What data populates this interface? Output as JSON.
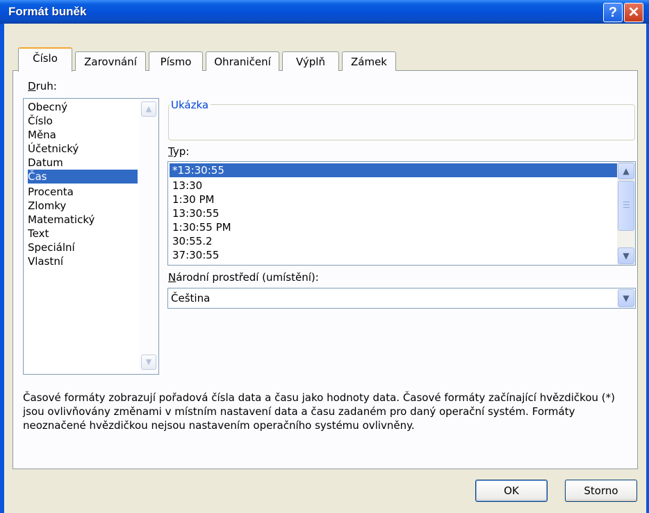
{
  "window": {
    "title": "Formát buněk",
    "help_glyph": "?",
    "close_glyph": "✕"
  },
  "tabs": [
    {
      "label": "Číslo",
      "active": true
    },
    {
      "label": "Zarovnání",
      "active": false
    },
    {
      "label": "Písmo",
      "active": false
    },
    {
      "label": "Ohraničení",
      "active": false
    },
    {
      "label": "Výplň",
      "active": false
    },
    {
      "label": "Zámek",
      "active": false
    }
  ],
  "category": {
    "label_first": "D",
    "label_rest": "ruh:",
    "items": [
      "Obecný",
      "Číslo",
      "Měna",
      "Účetnický",
      "Datum",
      "Čas",
      "Procenta",
      "Zlomky",
      "Matematický",
      "Text",
      "Speciální",
      "Vlastní"
    ],
    "selected": "Čas"
  },
  "sample": {
    "legend": "Ukázka",
    "value": ""
  },
  "type": {
    "label_first": "T",
    "label_rest": "yp:",
    "items": [
      "*13:30:55",
      "13:30",
      "1:30 PM",
      "13:30:55",
      "1:30:55 PM",
      "30:55.2",
      "37:30:55"
    ],
    "selected": "*13:30:55"
  },
  "locale": {
    "label_first": "N",
    "label_rest": "árodní prostředí (umístění):",
    "value": "Čeština"
  },
  "description": {
    "line1": "Časové formáty zobrazují pořadová čísla data a času jako hodnoty data. Časové formáty začínající hvězdičkou (*)",
    "line2": "jsou ovlivňovány změnami v místním nastavení data a času zadaném pro daný operační systém. Formáty",
    "line3": "neoznačené hvězdičkou nejsou nastavením operačního systému ovlivněny."
  },
  "buttons": {
    "ok": "OK",
    "cancel": "Storno"
  },
  "colors": {
    "titlebar": "#0550d8",
    "selection": "#316ac5",
    "active_tab_accent": "#f4a52f",
    "legend_text": "#0046d5"
  }
}
